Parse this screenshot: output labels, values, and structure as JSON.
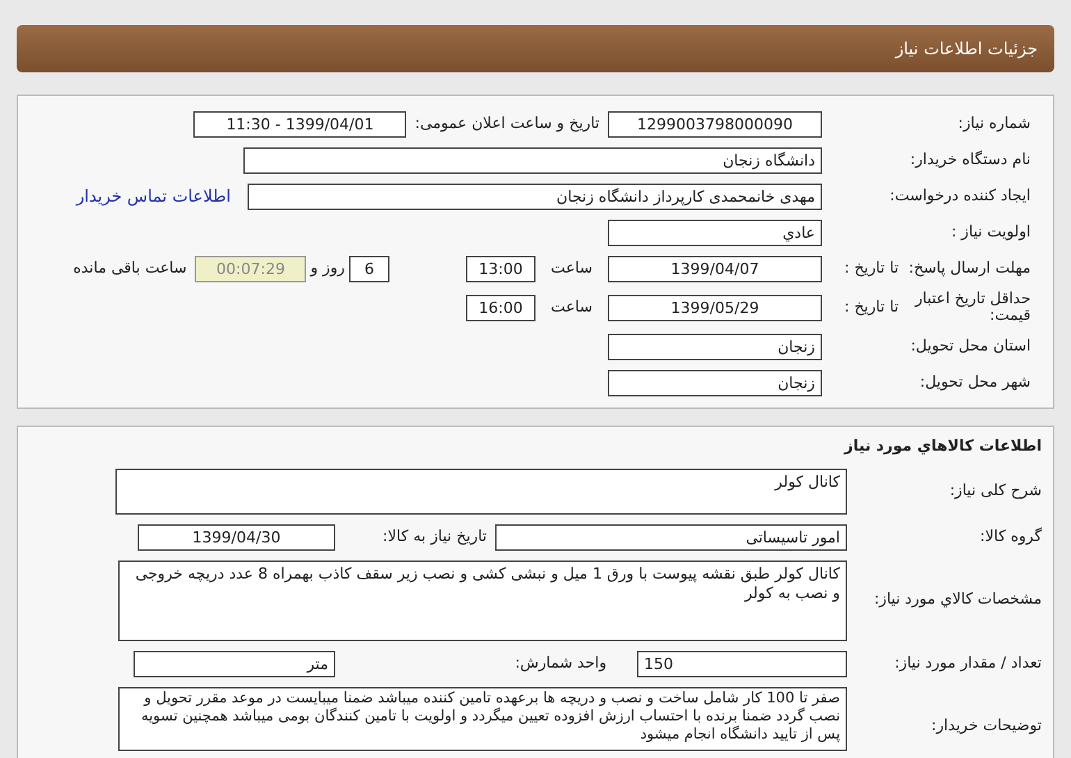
{
  "header": {
    "title": "جزئیات اطلاعات نیاز"
  },
  "need_info": {
    "need_number": {
      "label": "شماره نیاز:",
      "value": "1299003798000090"
    },
    "announce": {
      "label": "تاریخ و ساعت اعلان عمومی:",
      "value": "1399/04/01 - 11:30"
    },
    "buyer": {
      "label": "نام دستگاه خریدار:",
      "value": "دانشگاه زنجان"
    },
    "requester": {
      "label": "ایجاد کننده درخواست:",
      "value": "مهدی خانمحمدی کارپرداز دانشگاه زنجان",
      "link": "اطلاعات تماس خریدار"
    },
    "priority": {
      "label": "اولویت نیاز :",
      "value": "عادي"
    },
    "deadline": {
      "label": "مهلت ارسال پاسخ:",
      "to_date": "تا تاریخ :",
      "date": "1399/04/07",
      "time_label": "ساعت",
      "time": "13:00",
      "days": "6",
      "days_label": "روز و",
      "remaining": "00:07:29",
      "remaining_label": "ساعت باقی مانده"
    },
    "validity": {
      "label": "حداقل تاریخ اعتبار قیمت:",
      "to_date": "تا تاریخ :",
      "date": "1399/05/29",
      "time_label": "ساعت",
      "time": "16:00"
    },
    "province": {
      "label": "استان محل تحویل:",
      "value": "زنجان"
    },
    "city": {
      "label": "شهر محل تحویل:",
      "value": "زنجان"
    }
  },
  "goods": {
    "title": "اطلاعات کالاهاي مورد نیاز",
    "summary": {
      "label": "شرح کلی نیاز:",
      "value": "کانال کولر"
    },
    "group": {
      "label": "گروه کالا:",
      "value": "امور تاسیساتی",
      "date_label": "تاریخ نیاز به کالا:",
      "date": "1399/04/30"
    },
    "specs": {
      "label": "مشخصات کالاي مورد نیاز:",
      "value": "کانال کولر طبق نقشه پیوست با ورق 1 میل و نبشی کشی و نصب زیر سقف کاذب بهمراه 8 عدد دریچه خروجی و نصب به کولر"
    },
    "quantity": {
      "label": "تعداد / مقدار مورد نیاز:",
      "value": "150",
      "unit_label": "واحد شمارش:",
      "unit": "متر"
    },
    "notes": {
      "label": "توضیحات خریدار:",
      "value": "صفر تا 100 کار شامل ساخت و نصب و دریچه ها برعهده تامین کننده میباشد ضمنا میبایست در موعد مقرر تحویل و نصب گردد ضمنا برنده با احتساب ارزش افزوده تعیین میگردد و اولویت با تامین کنندگان بومی میباشد همچنین تسویه پس از تایید دانشگاه انجام میشود"
    }
  }
}
